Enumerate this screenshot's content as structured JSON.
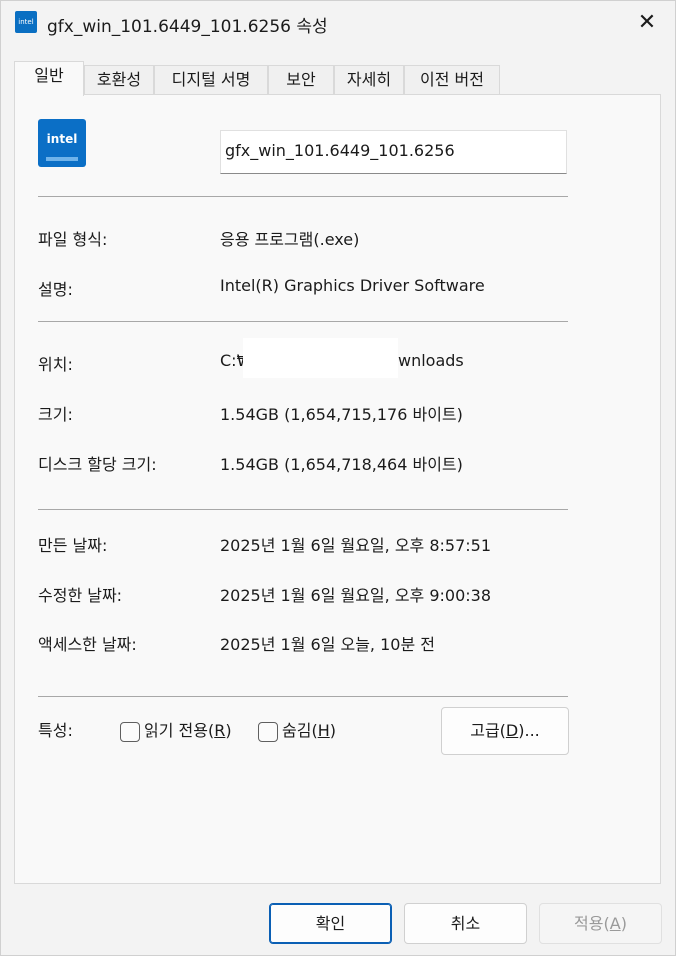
{
  "window": {
    "title": "gfx_win_101.6449_101.6256 속성",
    "close_glyph": "✕"
  },
  "tabs": [
    {
      "label": "일반",
      "active": true
    },
    {
      "label": "호환성"
    },
    {
      "label": "디지털 서명"
    },
    {
      "label": "보안"
    },
    {
      "label": "자세히"
    },
    {
      "label": "이전 버전"
    }
  ],
  "general": {
    "icon_text": "intel",
    "file_name": "gfx_win_101.6449_101.6256",
    "file_type": {
      "label": "파일 형식:",
      "value": "응용 프로그램(.exe)"
    },
    "description": {
      "label": "설명:",
      "value": "Intel(R) Graphics Driver Software"
    },
    "location": {
      "label": "위치:",
      "value_start": "C:₩",
      "value_end": "wnloads"
    },
    "size": {
      "label": "크기:",
      "value": "1.54GB (1,654,715,176 바이트)"
    },
    "size_on_disk": {
      "label": "디스크 할당 크기:",
      "value": "1.54GB (1,654,718,464 바이트)"
    },
    "created": {
      "label": "만든 날짜:",
      "value": "2025년 1월 6일 월요일, 오후 8:57:51"
    },
    "modified": {
      "label": "수정한 날짜:",
      "value": "2025년 1월 6일 월요일, 오후 9:00:38"
    },
    "accessed": {
      "label": "액세스한 날짜:",
      "value": "2025년 1월 6일 오늘, 10분 전"
    },
    "attributes": {
      "label": "특성:",
      "readonly": {
        "text": "읽기 전용(",
        "key": "R",
        "end": ")",
        "checked": false
      },
      "hidden": {
        "text": "숨김(",
        "key": "H",
        "end": ")",
        "checked": false
      },
      "advanced": {
        "text": "고급(",
        "key": "D",
        "end": ")..."
      }
    }
  },
  "buttons": {
    "ok": "확인",
    "cancel": "취소",
    "apply": {
      "text": "적용(",
      "key": "A",
      "end": ")"
    }
  }
}
